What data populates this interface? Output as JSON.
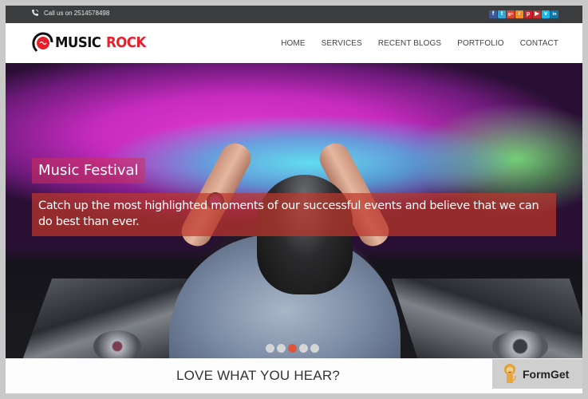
{
  "topbar": {
    "call_text": "Call us on 2514578498",
    "phone_icon": "phone-icon",
    "social": [
      {
        "name": "facebook",
        "glyph": "f",
        "color": "#3b5998"
      },
      {
        "name": "twitter",
        "glyph": "t",
        "color": "#33a6d8"
      },
      {
        "name": "google-plus",
        "glyph": "g+",
        "color": "#d34836"
      },
      {
        "name": "rss",
        "glyph": "r",
        "color": "#f28c1e"
      },
      {
        "name": "pinterest",
        "glyph": "p",
        "color": "#cb2027"
      },
      {
        "name": "youtube",
        "glyph": "▶",
        "color": "#c4302b"
      },
      {
        "name": "vimeo",
        "glyph": "v",
        "color": "#1ab7ea"
      },
      {
        "name": "linkedin",
        "glyph": "in",
        "color": "#0e76a8"
      }
    ]
  },
  "header": {
    "logo": {
      "part1": "MUSIC",
      "part2": "ROCK"
    },
    "nav": [
      "HOME",
      "SERVICES",
      "RECENT BLOGS",
      "PORTFOLIO",
      "CONTACT"
    ]
  },
  "hero": {
    "title": "Music Festival",
    "description": "Catch up the most highlighted moments of our successful events and believe that we can do best than ever.",
    "slides": 5,
    "active_slide": 3,
    "colors": {
      "active_dot": "#e0553a",
      "inactive_dot": "#d5d5d5"
    }
  },
  "section": {
    "heading": "LOVE WHAT YOU HEAR?"
  },
  "badge": {
    "text": "FormGet"
  }
}
